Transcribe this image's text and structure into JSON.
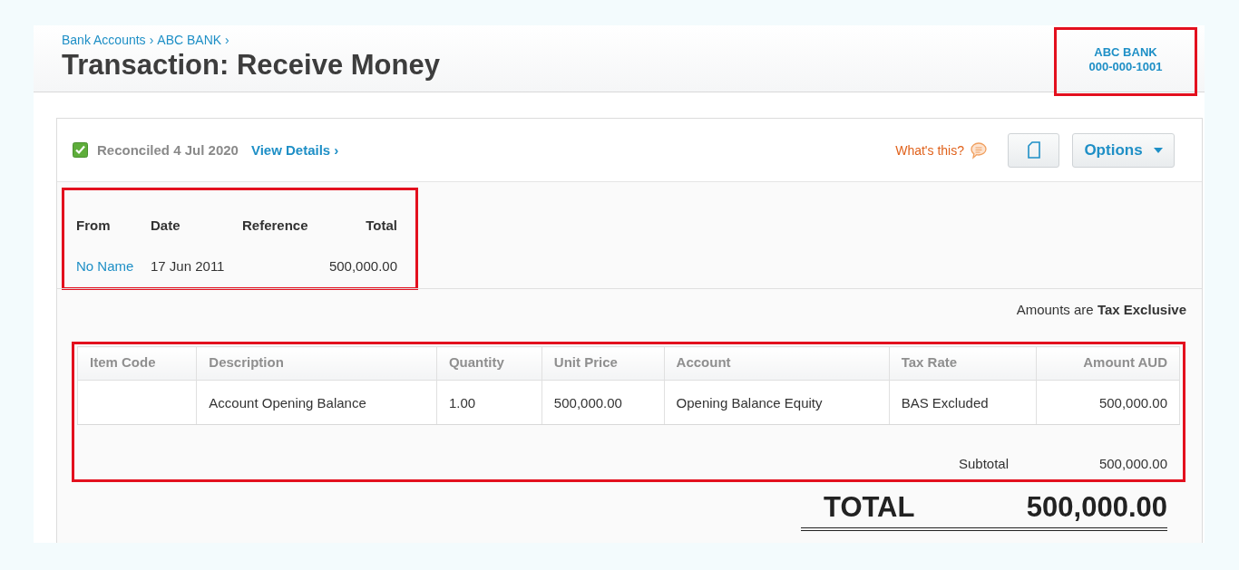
{
  "breadcrumb": [
    {
      "label": "Bank Accounts",
      "separator": "›"
    },
    {
      "label": "ABC BANK",
      "separator": "›"
    }
  ],
  "title": "Transaction: Receive Money",
  "account": {
    "name": "ABC BANK",
    "number": "000-000-1001",
    "highlighted": true
  },
  "status": {
    "checked": true,
    "text": "Reconciled 4 Jul 2020",
    "link": "View Details ›"
  },
  "help": "What's this?",
  "options_button": "Options",
  "summary": {
    "highlighted": true,
    "fields": [
      {
        "label": "From",
        "value": "No Name",
        "kind": "link"
      },
      {
        "label": "Date",
        "value": "17 Jun 2011",
        "kind": "text"
      },
      {
        "label": "Reference",
        "kind": "text"
      },
      {
        "label": "Total",
        "value": "500,000.00",
        "kind": "amount"
      }
    ]
  },
  "tax_note": "Amounts are **Tax Exclusive**",
  "table": {
    "highlighted": true,
    "columns": [
      "Item Code",
      "Description",
      "Quantity",
      "Unit Price",
      "Account",
      "Tax Rate",
      "Amount AUD"
    ],
    "rows": [
      {
        "description": "Account Opening Balance",
        "quantity": "1.00",
        "unit_price": "500,000.00",
        "account": "Opening Balance Equity",
        "tax_rate": "BAS Excluded",
        "amount": "500,000.00"
      }
    ],
    "subtotal_label": "Subtotal",
    "subtotal": "500,000.00"
  },
  "total_label": "TOTAL",
  "total": "500,000.00"
}
